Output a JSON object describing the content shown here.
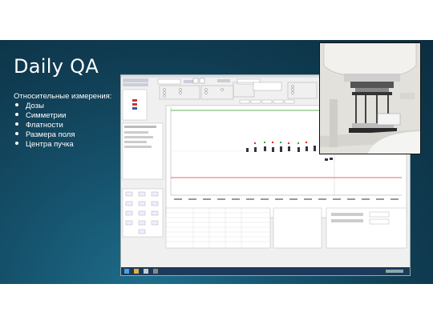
{
  "slide": {
    "title": "Daily QA",
    "subtitle": "Относительные измерения:",
    "bullets": [
      "Дозы",
      "Симметрии",
      "Флатности",
      "Размера поля",
      "Центра пучка"
    ]
  },
  "screenshot": {
    "description_icon": "app-window-screenshot"
  },
  "photo": {
    "icon": "linac-gantry-with-qa-device-photo"
  },
  "colors": {
    "slide_dark": "#0f3a4f",
    "slide_light": "#1e6f8d",
    "taskbar": "#1d3a5a",
    "red_line": "#e03030",
    "green_line": "#2a9a2a"
  }
}
